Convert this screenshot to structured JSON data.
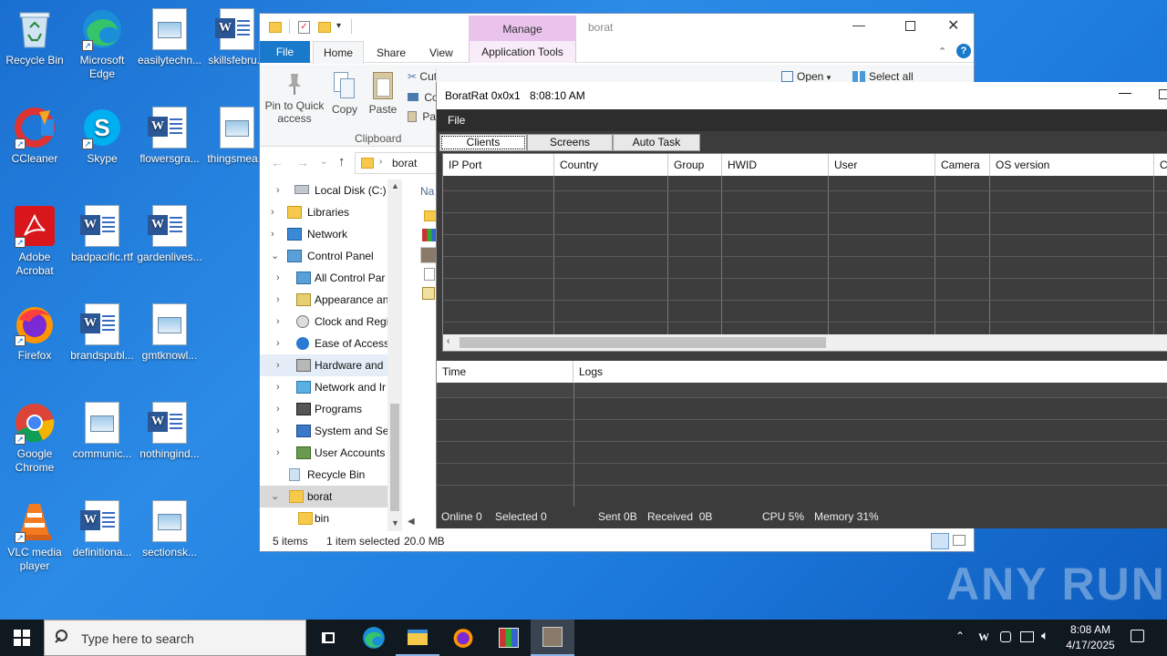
{
  "desktop": {
    "icons": [
      {
        "label": "Recycle Bin"
      },
      {
        "label": "Microsoft Edge"
      },
      {
        "label": "easilytechn..."
      },
      {
        "label": "skillsfebru..."
      },
      {
        "label": "CCleaner"
      },
      {
        "label": "Skype"
      },
      {
        "label": "flowersgra..."
      },
      {
        "label": "thingsmea..."
      },
      {
        "label": "Adobe Acrobat"
      },
      {
        "label": "badpacific.rtf"
      },
      {
        "label": "gardenlives..."
      },
      {
        "label": "Firefox"
      },
      {
        "label": "brandspubl..."
      },
      {
        "label": "gmtknowl..."
      },
      {
        "label": "Google Chrome"
      },
      {
        "label": "communic..."
      },
      {
        "label": "nothingind..."
      },
      {
        "label": "VLC media player"
      },
      {
        "label": "definitiona..."
      },
      {
        "label": "sectionsk..."
      }
    ],
    "watermark": "ANY RUN"
  },
  "explorer": {
    "title_folder": "borat",
    "manage_label": "Manage",
    "tabs": {
      "file": "File",
      "home": "Home",
      "share": "Share",
      "view": "View",
      "app_tools": "Application Tools"
    },
    "ribbon": {
      "pin": "Pin to Quick access",
      "copy": "Copy",
      "paste": "Paste",
      "cut": "Cut",
      "copy_path": "Co",
      "paste_shortcut": "Pas",
      "clipboard_group": "Clipboard",
      "open": "Open",
      "select_all": "Select all"
    },
    "address": "borat",
    "column_name": "Na",
    "tree": [
      {
        "label": "Local Disk (C:)",
        "chev": "›"
      },
      {
        "label": "Libraries",
        "chev": "›"
      },
      {
        "label": "Network",
        "chev": "›"
      },
      {
        "label": "Control Panel",
        "chev": "⌄"
      },
      {
        "label": "All Control Par",
        "chev": "›"
      },
      {
        "label": "Appearance an",
        "chev": "›"
      },
      {
        "label": "Clock and Regi",
        "chev": "›"
      },
      {
        "label": "Ease of Access",
        "chev": "›"
      },
      {
        "label": "Hardware and",
        "chev": "›"
      },
      {
        "label": "Network and Ir",
        "chev": "›"
      },
      {
        "label": "Programs",
        "chev": "›"
      },
      {
        "label": "System and Sec",
        "chev": "›"
      },
      {
        "label": "User Accounts",
        "chev": "›"
      },
      {
        "label": "Recycle Bin",
        "chev": ""
      },
      {
        "label": "borat",
        "chev": "⌄"
      },
      {
        "label": "bin",
        "chev": ""
      }
    ],
    "status": {
      "items": "5 items",
      "selected": "1 item selected",
      "size": "20.0 MB"
    }
  },
  "borat": {
    "title": "BoratRat 0x0x1",
    "time": "8:08:10 AM",
    "menu_file": "File",
    "tabs": [
      "Clients",
      "Screens",
      "Auto Task"
    ],
    "client_columns": [
      "IP Port",
      "Country",
      "Group",
      "HWID",
      "User",
      "Camera",
      "OS version",
      "Cl"
    ],
    "log_columns": [
      "Time",
      "Logs"
    ],
    "status": {
      "online": "Online 0",
      "selected": "Selected 0",
      "sent": "Sent 0B",
      "received": "Received  0B",
      "cpu": "CPU 5%",
      "memory": "Memory 31%"
    }
  },
  "taskbar": {
    "search_placeholder": "Type here to search",
    "time": "8:08 AM",
    "date": "4/17/2025"
  }
}
